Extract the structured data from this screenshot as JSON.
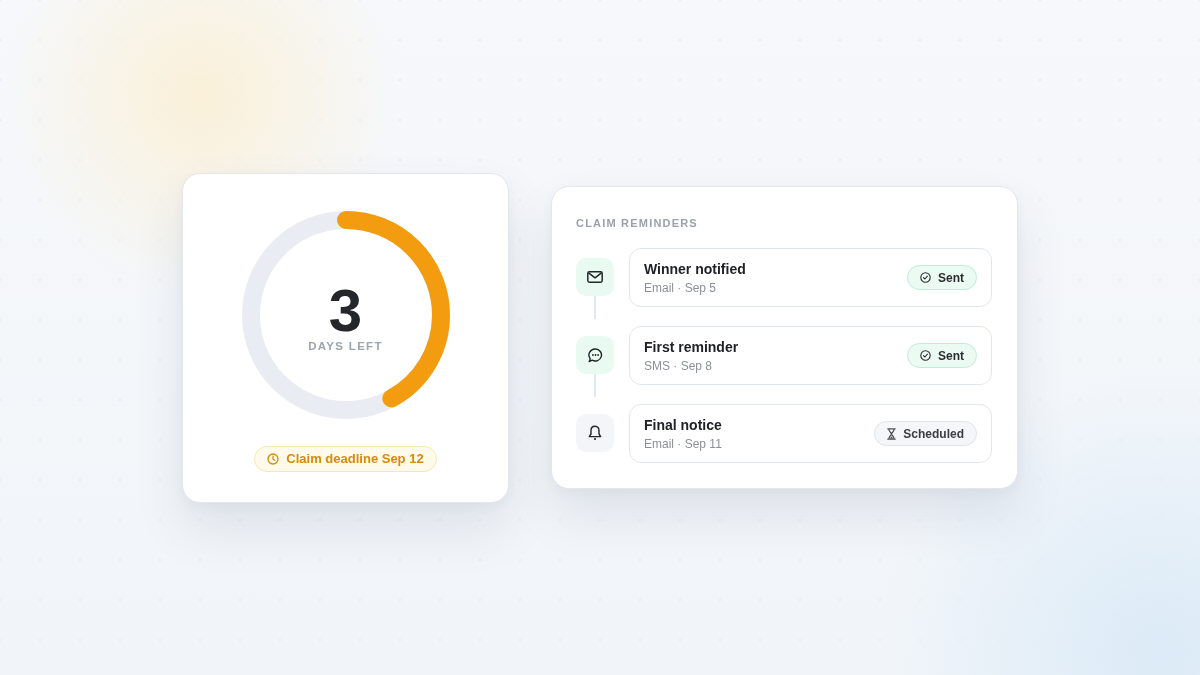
{
  "countdown": {
    "value": "3",
    "label": "DAYS LEFT",
    "level": 0.42,
    "deadline": "Claim deadline Sep 12"
  },
  "reminders": {
    "title": "CLAIM REMINDERS",
    "items": [
      {
        "kind": "email",
        "title": "Winner notified",
        "meta": "Email · Sep 5",
        "badge": {
          "kind": "done",
          "label": "Sent"
        }
      },
      {
        "kind": "sms",
        "title": "First reminder",
        "meta": "SMS · Sep 8",
        "badge": {
          "kind": "done",
          "label": "Sent"
        }
      },
      {
        "kind": "notice",
        "title": "Final notice",
        "meta": "Email · Sep 11",
        "badge": {
          "kind": "pending",
          "label": "Scheduled"
        }
      }
    ]
  }
}
